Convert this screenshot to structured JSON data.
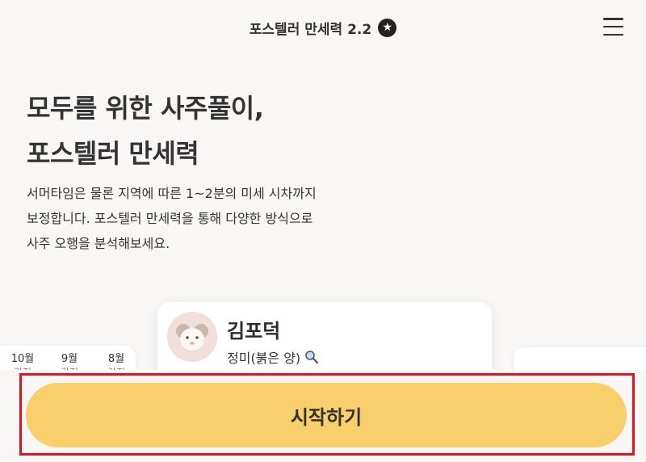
{
  "header": {
    "title": "포스텔러 만세력 2.2",
    "badge_icon": "star-icon",
    "menu_icon": "hamburger-menu-icon"
  },
  "hero": {
    "heading_line1": "모두를 위한 사주풀이,",
    "heading_line2": "포스텔러 만세력",
    "desc_line1": "서머타임은 물론 지역에 따른 1~2분의 미세 시차까지",
    "desc_line2": "보정합니다. 포스텔러 만세력을 통해 다양한 방식으로",
    "desc_line3": "사주 오행을 분석해보세요."
  },
  "cards": {
    "left_months": [
      {
        "label": "10월",
        "sub": "갑진"
      },
      {
        "label": "9월",
        "sub": "갑진"
      },
      {
        "label": "8월",
        "sub": "갑진"
      }
    ],
    "main": {
      "name": "김포덕",
      "subtitle": "정미(붉은 양)",
      "subtitle_icon": "magnifier-icon",
      "avatar": "sheep-avatar"
    }
  },
  "cta": {
    "start_label": "시작하기"
  },
  "colors": {
    "background": "#f8f7f5",
    "cta": "#f9cf6c",
    "highlight": "#e0141e"
  }
}
